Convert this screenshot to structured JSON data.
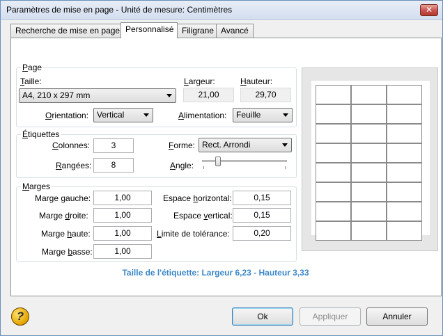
{
  "window": {
    "title": "Paramètres de mise en page - Unité de mesure: Centimètres",
    "close_glyph": "✕"
  },
  "tabs": [
    {
      "label": "Recherche de mise en page",
      "active": false
    },
    {
      "label": "Personnalisé",
      "active": true
    },
    {
      "label": "Filigrane",
      "active": false
    },
    {
      "label": "Avancé",
      "active": false
    }
  ],
  "page_group": {
    "title": "Page",
    "taille_label": "Taille:",
    "taille_value": "A4, 210 x 297 mm",
    "largeur_label": "Largeur:",
    "largeur_value": "21,00",
    "hauteur_label": "Hauteur:",
    "hauteur_value": "29,70",
    "orientation_label": "Orientation:",
    "orientation_value": "Vertical",
    "alimentation_label": "Alimentation:",
    "alimentation_value": "Feuille"
  },
  "etiquettes_group": {
    "title": "Étiquettes",
    "colonnes_label": "Colonnes:",
    "colonnes_value": "3",
    "rangees_label": "Rangées:",
    "rangees_value": "8",
    "forme_label": "Forme:",
    "forme_value": "Rect. Arrondi",
    "angle_label": "Angle:",
    "angle_fraction": 0.17
  },
  "marges_group": {
    "title": "Marges",
    "gauche_label": "Marge gauche:",
    "gauche_value": "1,00",
    "droite_label": "Marge droite:",
    "droite_value": "1,00",
    "haute_label": "Marge haute:",
    "haute_value": "1,00",
    "basse_label": "Marge basse:",
    "basse_value": "1,00",
    "esp_h_label": "Espace horizontal:",
    "esp_h_value": "0,15",
    "esp_v_label": "Espace vertical:",
    "esp_v_value": "0,15",
    "tolerance_label": "Limite de tolérance:",
    "tolerance_value": "0,20"
  },
  "preview": {
    "columns": 3,
    "rows": 8
  },
  "status_text": "Taille de l'étiquette: Largeur 6,23 - Hauteur 3,33",
  "buttons": {
    "ok": "Ok",
    "apply": "Appliquer",
    "cancel": "Annuler",
    "help_glyph": "?"
  },
  "colors": {
    "status_text": "#3a87c8",
    "title_bar": "#d3def0",
    "close_button": "#c75050"
  }
}
